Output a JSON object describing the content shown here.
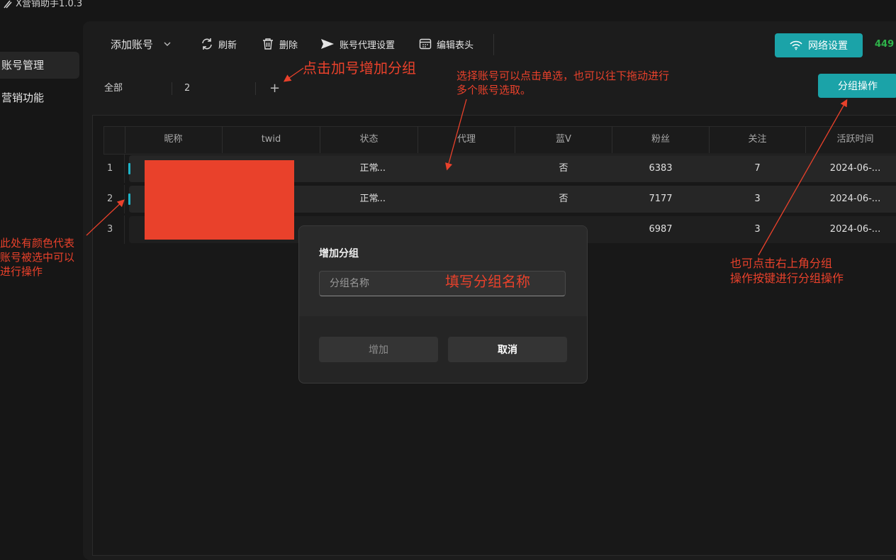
{
  "app": {
    "title": "X营销助手1.0.3"
  },
  "sidebar": {
    "items": [
      {
        "label": "账号管理",
        "active": true
      },
      {
        "label": "营销功能",
        "active": false
      }
    ]
  },
  "toolbar": {
    "add_account": "添加账号",
    "refresh": "刷新",
    "delete": "删除",
    "proxy_settings": "账号代理设置",
    "edit_header": "编辑表头",
    "network_settings": "网络设置",
    "count": "449"
  },
  "groups": {
    "tabs": [
      {
        "label": "全部"
      },
      {
        "label": "2"
      }
    ],
    "add_symbol": "+",
    "operation_button": "分组操作"
  },
  "table": {
    "columns": [
      "昵称",
      "twid",
      "状态",
      "代理",
      "蓝V",
      "粉丝",
      "关注",
      "活跃时间"
    ],
    "rows": [
      {
        "index": "1",
        "twid": "...",
        "status": "正常",
        "blue_v": "否",
        "fans": "6383",
        "follow": "7",
        "active_time": "2024-06-..."
      },
      {
        "index": "2",
        "twid": "...",
        "status": "正常",
        "blue_v": "否",
        "fans": "7177",
        "follow": "3",
        "active_time": "2024-06-..."
      },
      {
        "index": "3",
        "twid": "",
        "status": "",
        "blue_v": "",
        "fans": "6987",
        "follow": "3",
        "active_time": "2024-06-..."
      }
    ]
  },
  "modal": {
    "title": "增加分组",
    "input_placeholder": "分组名称",
    "add_button": "增加",
    "cancel_button": "取消"
  },
  "annotations": {
    "click_plus": "点击加号增加分组",
    "select_line1": "选择账号可以点击单选，也可以往下拖动进行",
    "select_line2": "多个账号选取。",
    "color_line1": "此处有颜色代表",
    "color_line2": "账号被选中可以",
    "color_line3": "进行操作",
    "fill_name": "填写分组名称",
    "topright_line1": "也可点击右上角分组",
    "topright_line2": "操作按键进行分组操作"
  },
  "colors": {
    "accent": "#1ba3a8",
    "annotation": "#e9412b",
    "selection_bar": "#1eb4c8",
    "count": "#2eb34a"
  },
  "icons": [
    "app-logo-icon",
    "chevron-down-icon",
    "refresh-icon",
    "trash-icon",
    "send-icon",
    "table-icon",
    "wifi-icon",
    "plus-icon"
  ]
}
